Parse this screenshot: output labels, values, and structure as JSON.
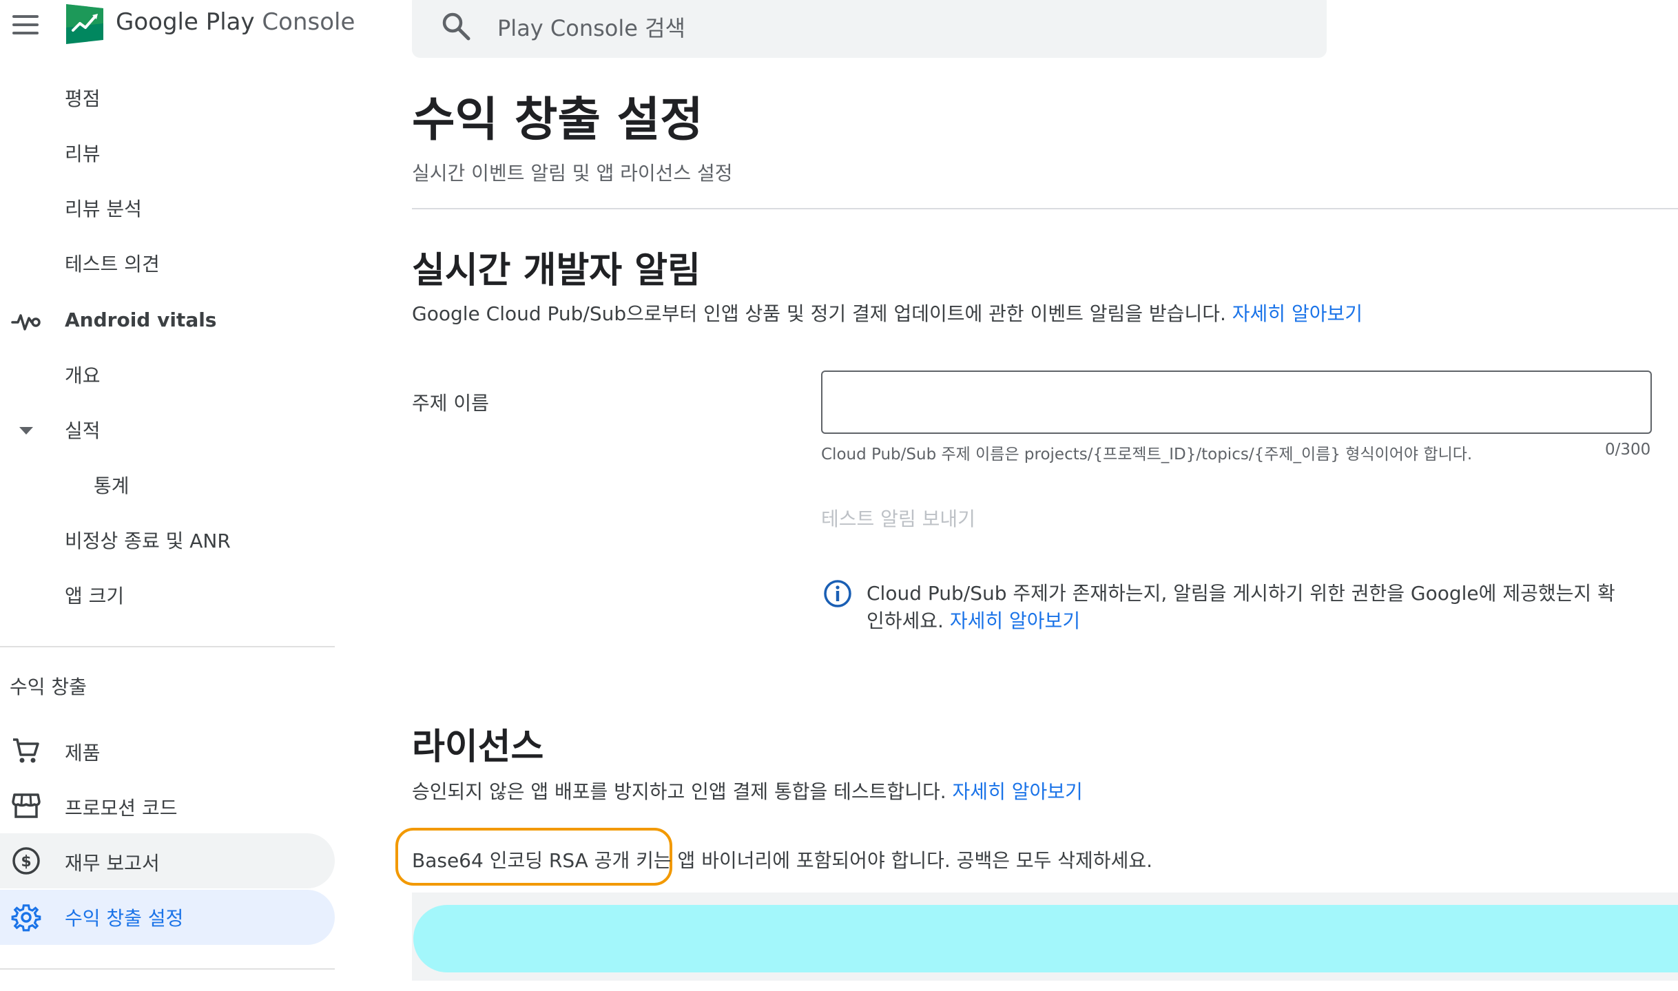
{
  "app": {
    "brand_google": "Google Play",
    "brand_console": "Console",
    "logo_icon": "play-console-logo-icon",
    "menu_icon": "hamburger-menu-icon"
  },
  "search": {
    "placeholder": "Play Console 검색",
    "icon": "search-icon"
  },
  "sidebar": {
    "items_top": [
      {
        "label": "평점"
      },
      {
        "label": "리뷰"
      },
      {
        "label": "리뷰 분석"
      },
      {
        "label": "테스트 의견"
      }
    ],
    "vitals_section": "Android vitals",
    "vitals_icon": "vitals-pulse-icon",
    "vitals_items": [
      {
        "label": "개요"
      },
      {
        "label": "실적"
      },
      {
        "label": "통계"
      },
      {
        "label": "비정상 종료 및 ANR"
      },
      {
        "label": "앱 크기"
      }
    ],
    "monetize_section": "수익 창출",
    "monetize_items": [
      {
        "label": "제품",
        "icon": "shopping-cart-icon"
      },
      {
        "label": "프로모션 코드",
        "icon": "storefront-icon"
      },
      {
        "label": "재무 보고서",
        "icon": "dollar-circle-icon"
      },
      {
        "label": "수익 창출 설정",
        "icon": "gear-icon"
      }
    ]
  },
  "page": {
    "title": "수익 창출 설정",
    "subtitle": "실시간 이벤트 알림 및 앱 라이선스 설정"
  },
  "rtdn": {
    "heading": "실시간 개발자 알림",
    "description": "Google Cloud Pub/Sub으로부터 인앱 상품 및 정기 결제 업데이트에 관한 이벤트 알림을 받습니다.",
    "learn_more": "자세히 알아보기",
    "topic_label": "주제 이름",
    "topic_value": "",
    "helper_text": "Cloud Pub/Sub 주제 이름은 projects/{프로젝트_ID}/topics/{주제_이름} 형식이어야 합니다.",
    "counter": "0/300",
    "send_test_button": "테스트 알림 보내기",
    "info_line1": "Cloud Pub/Sub 주제가 존재하는지, 알림을 게시하기 위한 권한을 Google에 제공했는지 확",
    "info_line2": "인하세요.",
    "info_learn_more": "자세히 알아보기",
    "info_icon": "info-icon"
  },
  "licensing": {
    "heading": "라이선스",
    "description": "승인되지 않은 앱 배포를 방지하고 인앱 결제 통합을 테스트합니다.",
    "learn_more": "자세히 알아보기",
    "key_label_highlight": "Base64 인코딩 RSA 공개 키는",
    "key_label_rest": " 앱 바이너리에 포함되어야 합니다. 공백은 모두 삭제하세요."
  },
  "colors": {
    "accent": "#1a73e8",
    "selected_bg": "#e8f0fe",
    "hover_bg": "#f1f3f4",
    "highlight_outline": "#f29900",
    "key_fill": "#a3f7fb"
  }
}
